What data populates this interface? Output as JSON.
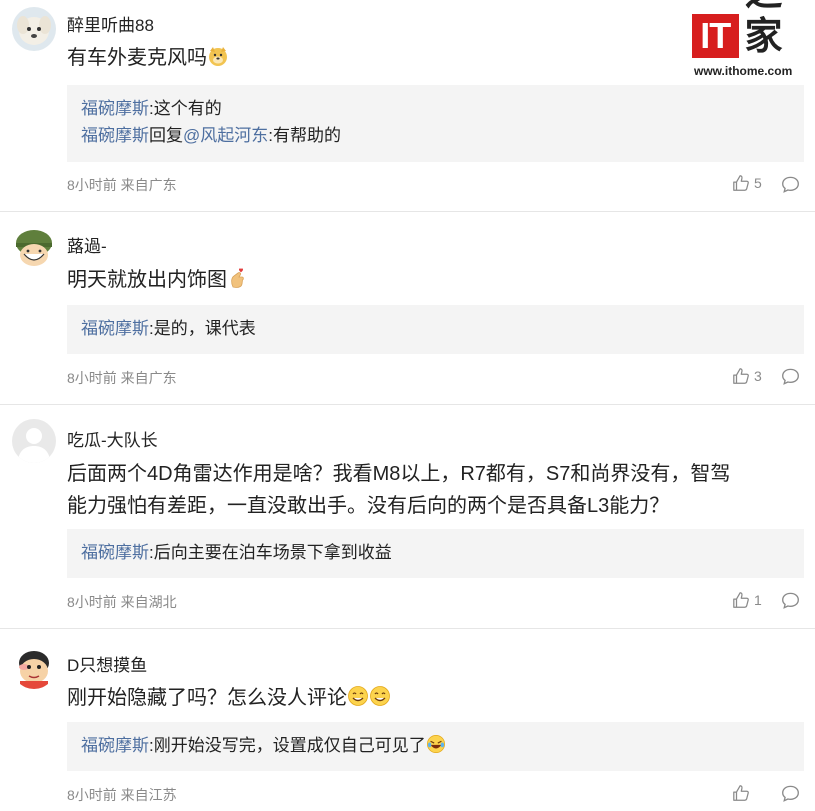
{
  "watermark": {
    "logo_text": "IT之家",
    "it_text": "IT",
    "zhi_text": "之家",
    "url": "www.ithome.com"
  },
  "colors": {
    "reply_name": "#4e6fa0",
    "meta": "#8a8a8a",
    "reply_bg": "#f4f4f4",
    "brand_red": "#d71e1e"
  },
  "comments": [
    {
      "username": "醉里听曲88",
      "text": "有车外麦克风吗",
      "emoji": "doge-emoji",
      "replies": [
        {
          "user": "福碗摩斯",
          "text": ":这个有的"
        },
        {
          "user": "福碗摩斯",
          "middle": "回复",
          "mention": "@风起河东",
          "text": ":有帮助的"
        }
      ],
      "meta": "8小时前 来自广东",
      "likes": "5"
    },
    {
      "username": "蕗過-",
      "text": "明天就放出内饰图",
      "emoji": "finger-heart-emoji",
      "replies": [
        {
          "user": "福碗摩斯",
          "text": ":是的，课代表"
        }
      ],
      "meta": "8小时前 来自广东",
      "likes": "3"
    },
    {
      "username": "吃瓜-大队长",
      "text_line1": "后面两个4D角雷达作用是啥？我看M8以上，R7都有，S7和尚界没有，智驾",
      "text_line2": "能力强怕有差距，一直没敢出手。没有后向的两个是否具备L3能力？",
      "replies": [
        {
          "user": "福碗摩斯",
          "text": ":后向主要在泊车场景下拿到收益"
        }
      ],
      "meta": "8小时前 来自湖北",
      "likes": "1"
    },
    {
      "username": "D只想摸鱼",
      "text": "刚开始隐藏了吗？怎么没人评论",
      "emoji": "smile-emoji",
      "replies": [
        {
          "user": "福碗摩斯",
          "text": ":刚开始没写完，设置成仅自己可见了"
        }
      ],
      "meta": "8小时前 来自江苏",
      "likes": ""
    }
  ]
}
